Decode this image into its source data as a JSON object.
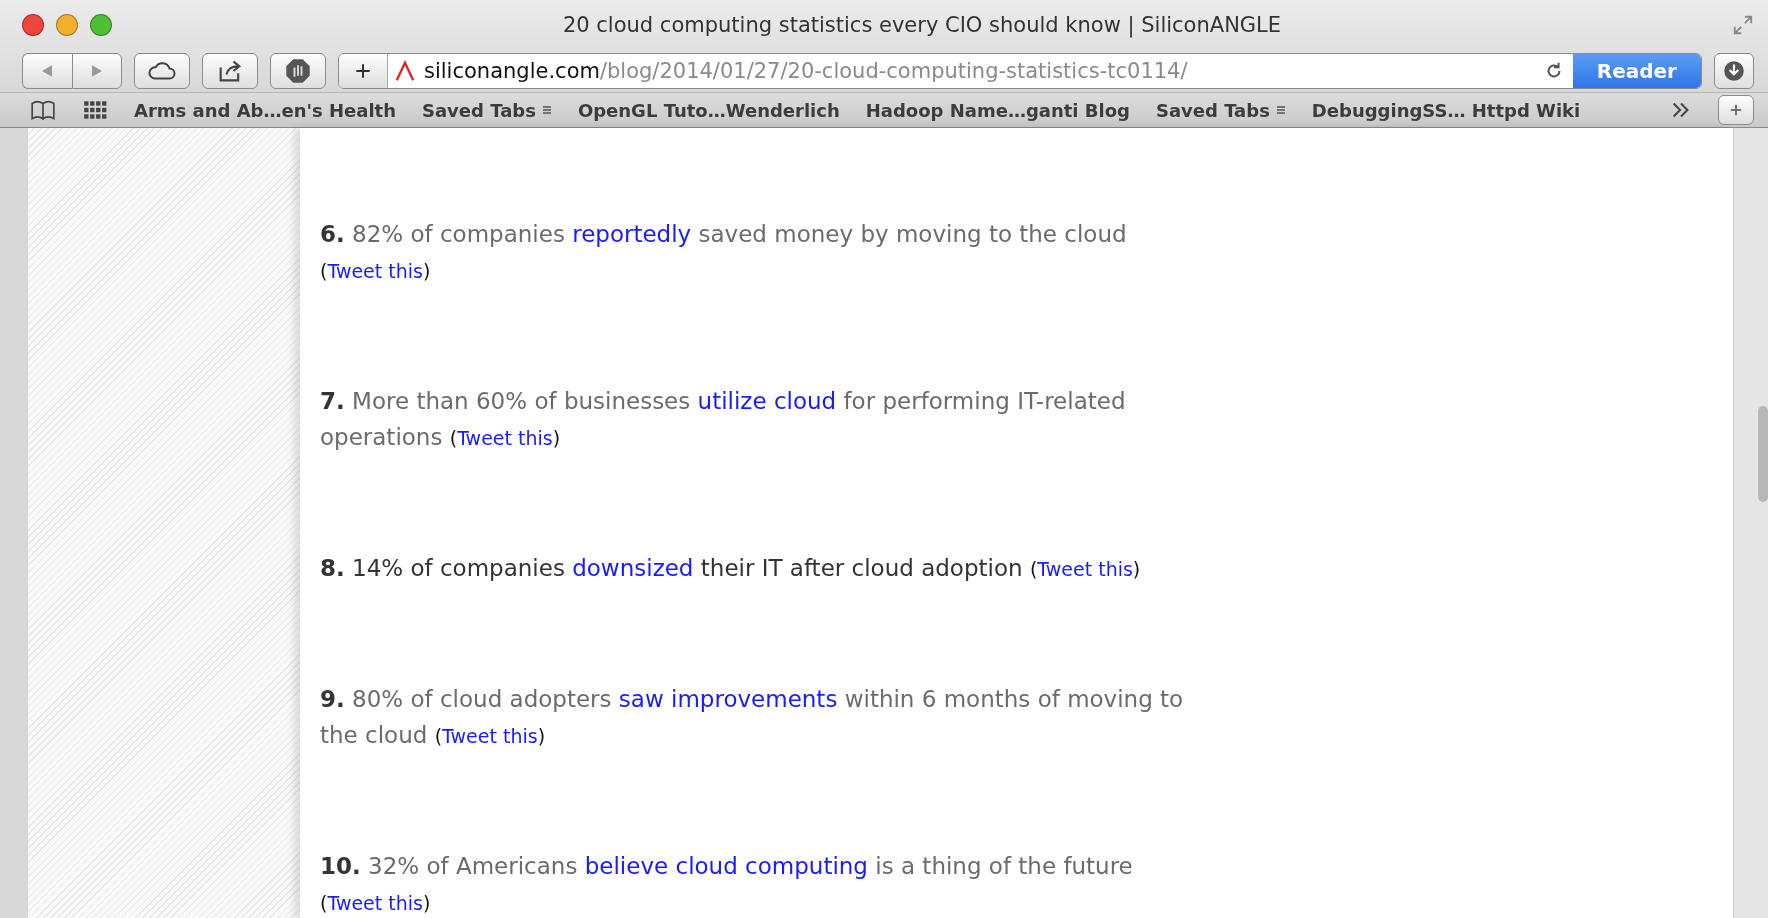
{
  "window": {
    "title": "20 cloud computing statistics every CIO should know | SiliconANGLE"
  },
  "toolbar": {
    "url_domain": "siliconangle.com",
    "url_path": "/blog/2014/01/27/20-cloud-computing-statistics-tc0114/",
    "reader_button": "Reader"
  },
  "bookmarks": [
    {
      "label": "Arms and Ab…en's Health",
      "kind": "link"
    },
    {
      "label": "Saved Tabs",
      "kind": "folder"
    },
    {
      "label": "OpenGL Tuto…Wenderlich",
      "kind": "link"
    },
    {
      "label": "Hadoop Name…ganti Blog",
      "kind": "link"
    },
    {
      "label": "Saved Tabs",
      "kind": "folder"
    },
    {
      "label": "DebuggingSS… Httpd Wiki",
      "kind": "link"
    }
  ],
  "article": {
    "items": [
      {
        "number": "6.",
        "before": " 82% of companies ",
        "link": "reportedly",
        "after": " saved money by moving to the cloud ",
        "tweet_open": "(",
        "tweet": "Tweet this",
        "tweet_close": ")",
        "dark": false
      },
      {
        "number": "7.",
        "before": " More than 60% of businesses ",
        "link": "utilize cloud",
        "after": " for performing IT-related operations ",
        "tweet_open": "(",
        "tweet": "Tweet this",
        "tweet_close": ")",
        "dark": false
      },
      {
        "number": "8.",
        "before": " 14% of companies ",
        "link": "downsized",
        "after": " their IT after cloud adoption ",
        "tweet_open": "(",
        "tweet": "Tweet this",
        "tweet_close": ")",
        "dark": true
      },
      {
        "number": "9.",
        "before": " 80% of cloud adopters ",
        "link": "saw improvements",
        "after": " within 6 months of moving to the cloud  ",
        "tweet_open": "(",
        "tweet": "Tweet this",
        "tweet_close": ")",
        "dark": false
      },
      {
        "number": "10.",
        "before": " 32% of Americans ",
        "link": "believe cloud computing",
        "after": " is a thing of the future ",
        "tweet_open": "(",
        "tweet": "Tweet this",
        "tweet_close": ")",
        "dark": false
      }
    ]
  }
}
